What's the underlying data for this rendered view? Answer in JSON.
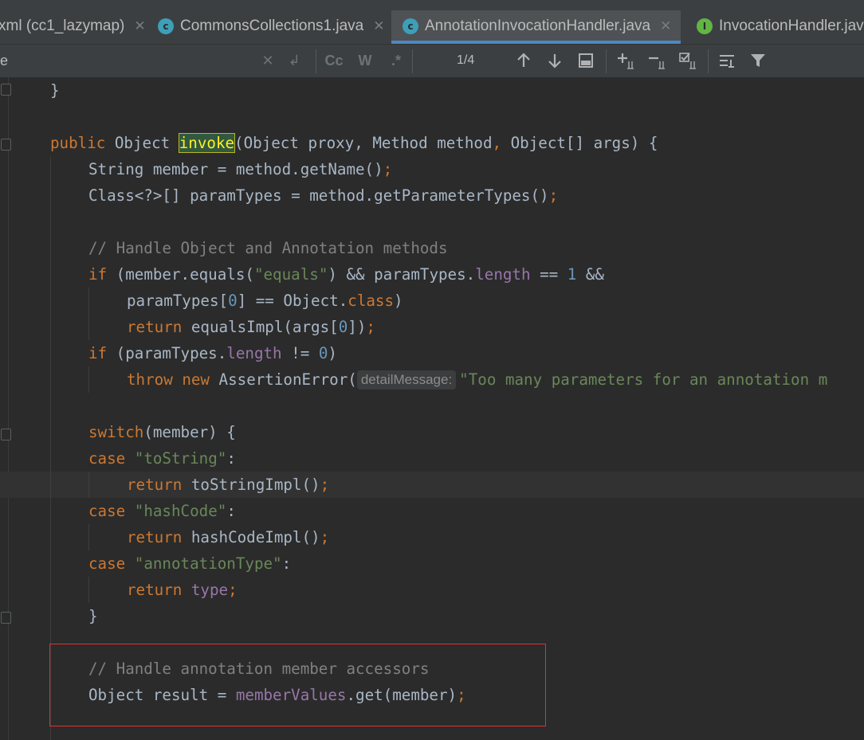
{
  "tabs": [
    {
      "label": "xml (cc1_lazymap)",
      "icon": "xml-file-icon",
      "active": false
    },
    {
      "label": "CommonsCollections1.java",
      "icon": "java-class-icon",
      "active": false
    },
    {
      "label": "AnnotationInvocationHandler.java",
      "icon": "java-class-icon",
      "active": true
    },
    {
      "label": "InvocationHandler.jav",
      "icon": "java-interface-icon",
      "active": false
    }
  ],
  "search": {
    "value": "e",
    "match_count": "1/4",
    "toggles": [
      "Cc",
      "W",
      ".*"
    ]
  },
  "hint": {
    "detailMessage": "detailMessage:"
  },
  "code": {
    "l1": "}",
    "l3_kw": "public",
    "l3_a": " Object ",
    "l3_match": "invoke",
    "l3_b": "(Object proxy, Method method",
    "l3_comma1": ",",
    "l3_c": " Object[] args) {",
    "l4_a": "String member = method.getName()",
    "l4_semi": ";",
    "l5_a": "Class<?>[] paramTypes = method.getParameterTypes()",
    "l5_semi": ";",
    "l7": "// Handle Object and Annotation methods",
    "l8_kw": "if",
    "l8_a": " (member.equals(",
    "l8_str": "\"equals\"",
    "l8_b": ") && paramTypes.",
    "l8_fld": "length",
    "l8_c": " == ",
    "l8_num": "1",
    "l8_d": " &&",
    "l9_a": "paramTypes[",
    "l9_num": "0",
    "l9_b": "] == Object.",
    "l9_kw": "class",
    "l9_c": ")",
    "l10_kw": "return",
    "l10_a": " equalsImpl(args[",
    "l10_num": "0",
    "l10_b": "])",
    "l10_semi": ";",
    "l11_kw": "if",
    "l11_a": " (paramTypes.",
    "l11_fld": "length",
    "l11_b": " != ",
    "l11_num": "0",
    "l11_c": ")",
    "l12_kw1": "throw",
    "l12_kw2": "new",
    "l12_a": " AssertionError(",
    "l12_str": "\"Too many parameters for an annotation m",
    "l14_kw": "switch",
    "l14_a": "(member) {",
    "l15_kw": "case",
    "l15_str": "\"toString\"",
    "l15_a": ":",
    "l16_kw": "return",
    "l16_a": " toStringImpl()",
    "l16_semi": ";",
    "l17_kw": "case",
    "l17_str": "\"hashCode\"",
    "l17_a": ":",
    "l18_kw": "return",
    "l18_a": " hashCodeImpl()",
    "l18_semi": ";",
    "l19_kw": "case",
    "l19_str": "\"annotationType\"",
    "l19_a": ":",
    "l20_kw": "return",
    "l20_fld": "type",
    "l20_semi": ";",
    "l21": "}",
    "l23": "// Handle annotation member accessors",
    "l24_a": "Object result = ",
    "l24_fld": "memberValues",
    "l24_b": ".get(member)",
    "l24_semi": ";"
  }
}
